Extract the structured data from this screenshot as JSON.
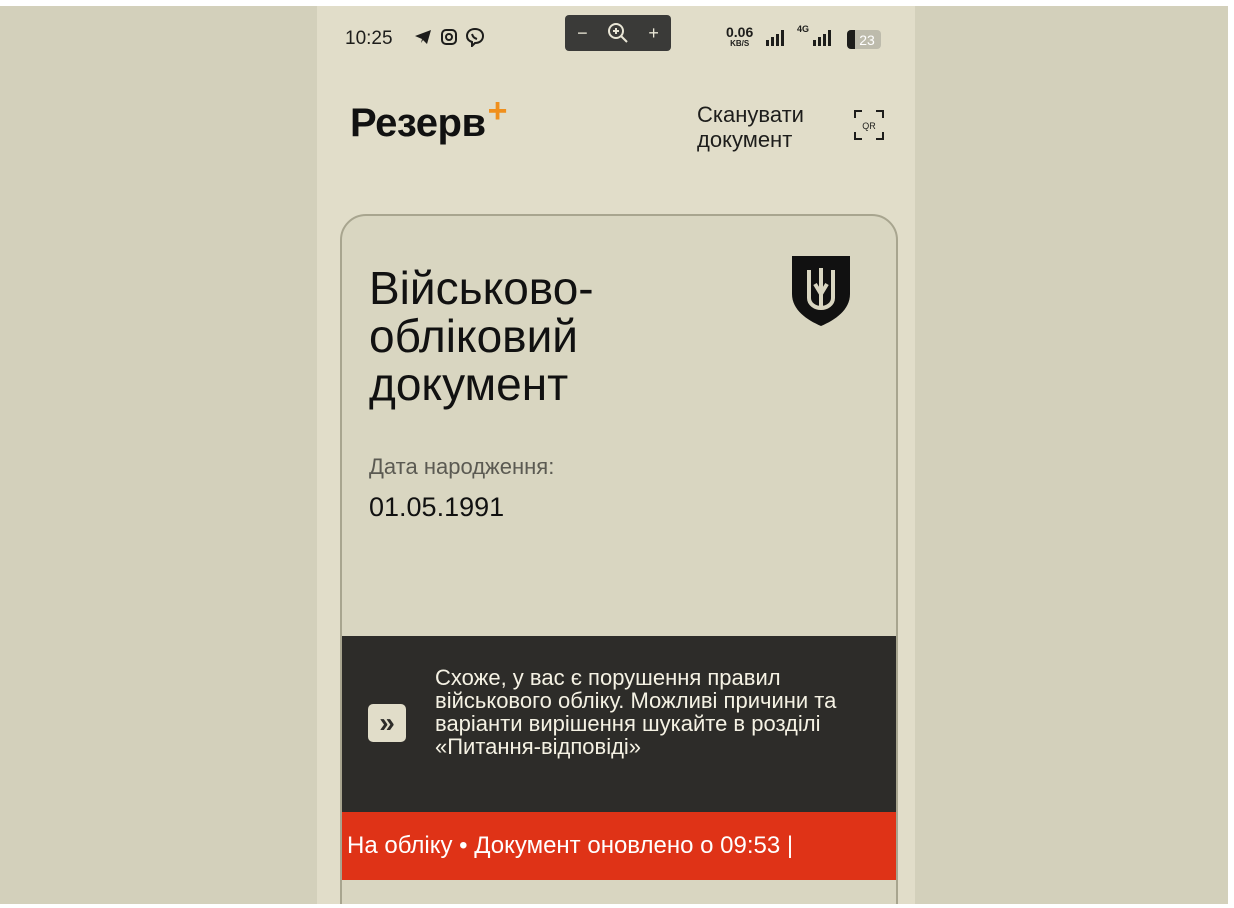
{
  "status_bar": {
    "time": "10:25",
    "net_speed": "0.06",
    "net_unit": "KB/S",
    "network": "4G",
    "battery": "23"
  },
  "zoom_controls": {
    "minus": "−",
    "plus": "+"
  },
  "header": {
    "logo": "Резерв",
    "logo_plus": "+",
    "scan_label": "Сканувати документ",
    "qr_label": "QR"
  },
  "document": {
    "title": "Військово-обліковий документ",
    "dob_label": "Дата народження:",
    "dob_value": "01.05.1991",
    "warning": "Схоже, у вас є порушення правил військового обліку. Можливі причини та варіанти вирішення шукайте в розділі «Питання-відповіді»",
    "warning_icon": "»",
    "ticker": "На обліку • Документ оновлено о 09:53 |"
  },
  "colors": {
    "accent_orange": "#f08f1c",
    "ticker_red": "#df3317",
    "warning_bg": "#2d2c29",
    "card_bg": "#d9d6c1"
  }
}
